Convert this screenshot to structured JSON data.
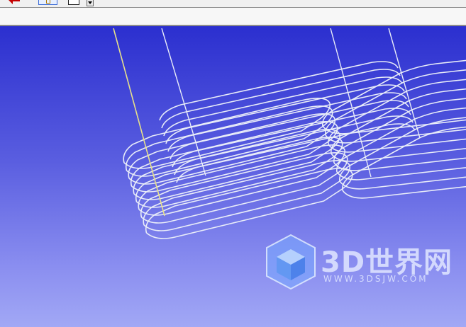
{
  "toolbar": {
    "back_icon": "red-back-arrow-icon",
    "tool_icon": "pointer-tool-icon",
    "frame_icon": "frame-icon",
    "dropdown_icon": "chevron-down-icon"
  },
  "address_bar": {
    "value": ""
  },
  "viewport": {
    "background_top": "#2b2fcf",
    "background_bottom": "#a2a8f5",
    "wire_color": "#e8ecf8",
    "highlight_wire_color": "#e6e08a"
  },
  "watermark": {
    "title": "3D世界网",
    "url": "WWW.3DSJW.COM"
  }
}
